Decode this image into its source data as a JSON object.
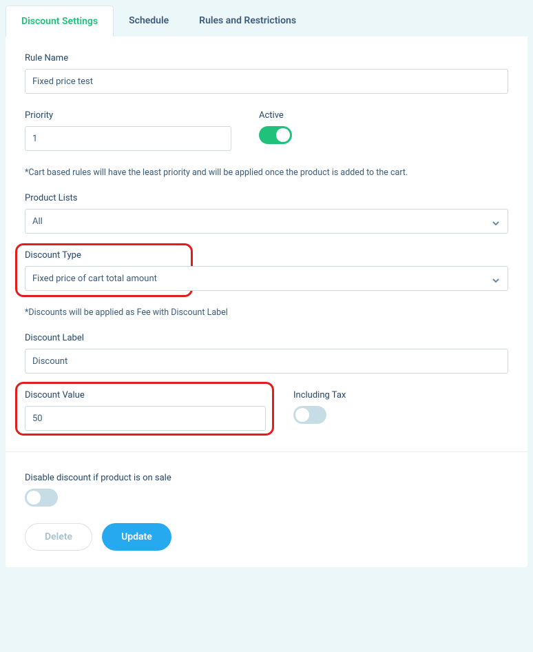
{
  "tabs": {
    "discount_settings": "Discount Settings",
    "schedule": "Schedule",
    "rules": "Rules and Restrictions"
  },
  "labels": {
    "rule_name": "Rule Name",
    "priority": "Priority",
    "active": "Active",
    "product_lists": "Product Lists",
    "discount_type": "Discount Type",
    "discount_label": "Discount Label",
    "discount_value": "Discount Value",
    "including_tax": "Including Tax",
    "disable_on_sale": "Disable discount if product is on sale"
  },
  "values": {
    "rule_name": "Fixed price test",
    "priority": "1",
    "product_lists": "All",
    "discount_type": "Fixed price of cart total amount",
    "discount_label": "Discount",
    "discount_value": "50"
  },
  "help": {
    "cart_priority": "*Cart based rules will have the least priority and will be applied once the product is added to the cart.",
    "fee_note": "*Discounts will be applied as Fee with Discount Label"
  },
  "buttons": {
    "delete": "Delete",
    "update": "Update"
  },
  "toggles": {
    "active": true,
    "including_tax": false,
    "disable_on_sale": false
  }
}
